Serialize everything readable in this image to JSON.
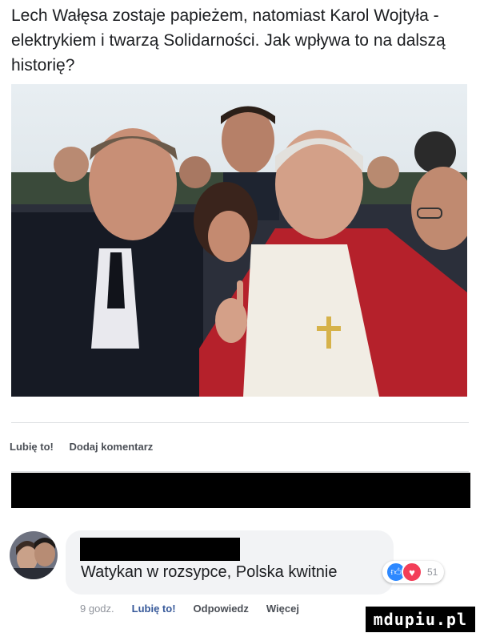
{
  "post": {
    "text": "Lech Wałęsa zostaje papieżem, natomiast Karol Wojtyła - elektrykiem i twarzą Solidarności. Jak wpływa to na dalszą historię?"
  },
  "post_actions": {
    "like": "Lubię to!",
    "comment": "Dodaj komentarz"
  },
  "comment": {
    "text": "Watykan w rozsypce, Polska kwitnie",
    "reaction_count": "51",
    "time": "9 godz.",
    "like": "Lubię to!",
    "reply": "Odpowiedz",
    "more": "Więcej"
  },
  "watermark": "mdupiu.pl",
  "colors": {
    "accent_blue": "#365899",
    "like_blue": "#2d88ff",
    "love_red": "#f33e58",
    "bubble_bg": "#f2f3f5"
  }
}
